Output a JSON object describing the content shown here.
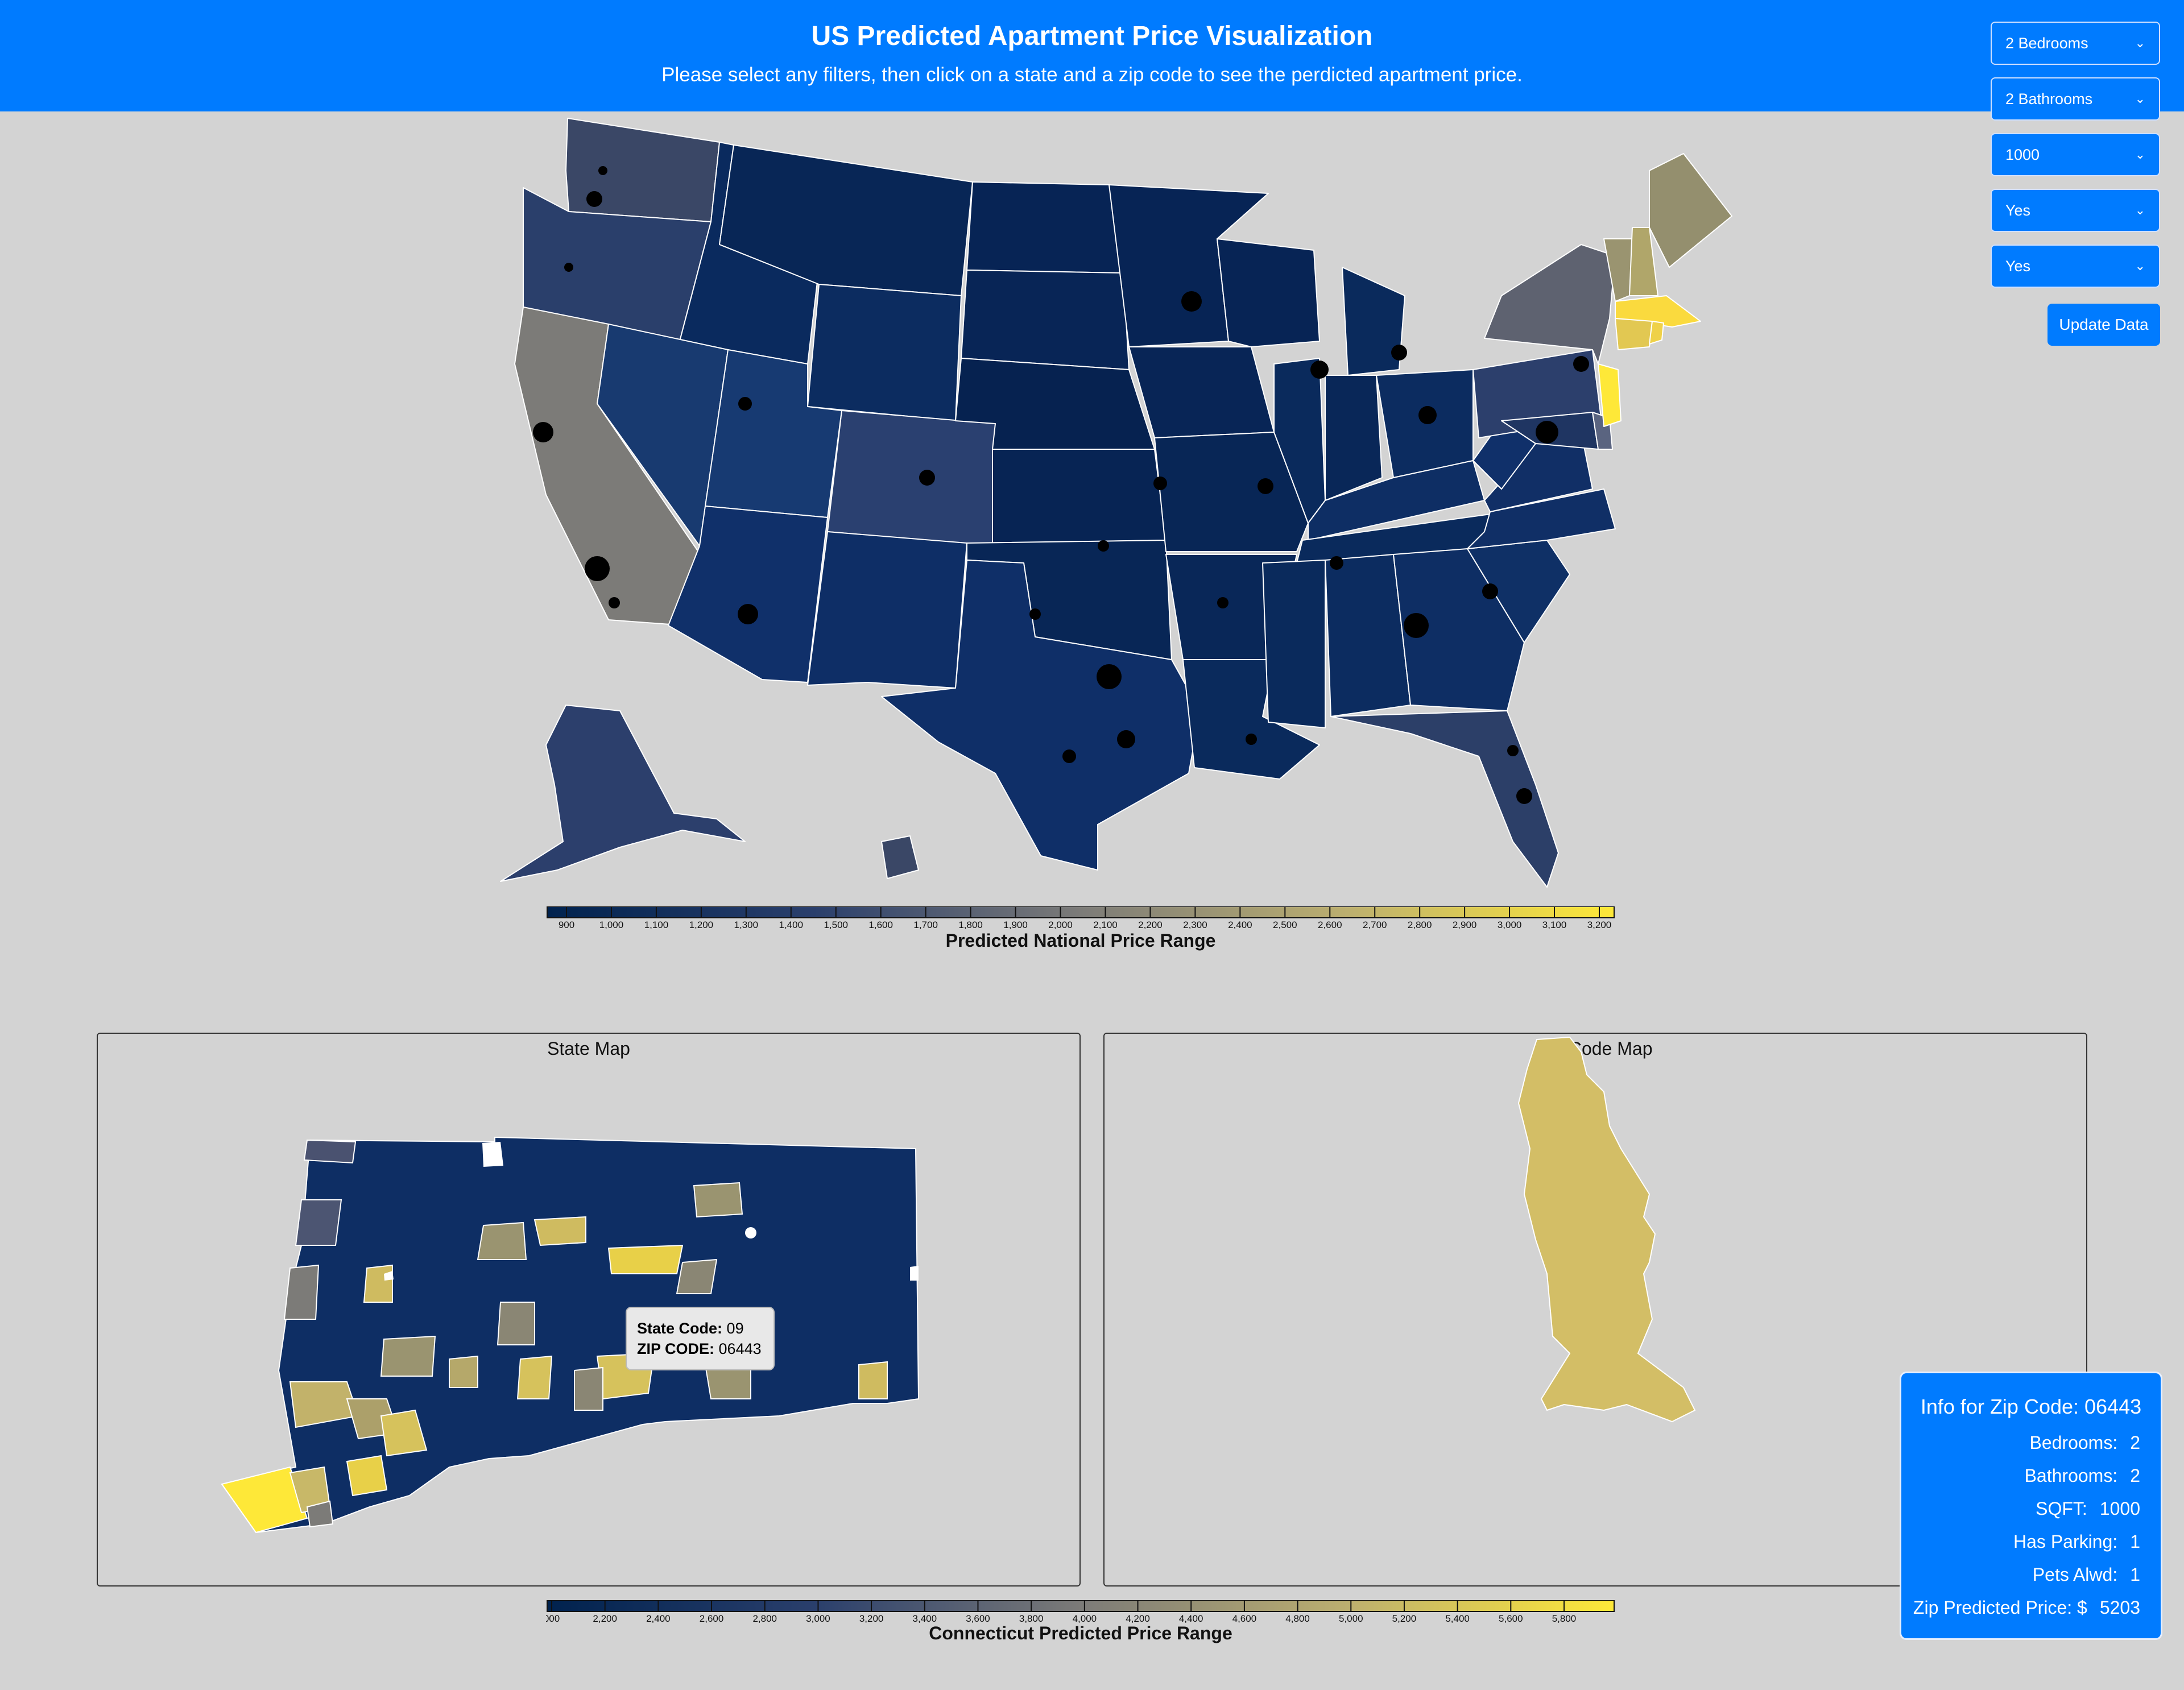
{
  "header": {
    "title": "US Predicted Apartment Price Visualization",
    "subtitle": "Please select any filters, then click on a state and a zip code to see the perdicted apartment price."
  },
  "filters": {
    "bedrooms": "2 Bedrooms",
    "bathrooms": "2 Bathrooms",
    "sqft": "1000",
    "parking": "Yes",
    "pets": "Yes",
    "update_label": "Update Data"
  },
  "national_legend": {
    "title": "Predicted National Price Range",
    "ticks": [
      "900",
      "1,000",
      "1,100",
      "1,200",
      "1,300",
      "1,400",
      "1,500",
      "1,600",
      "1,700",
      "1,800",
      "1,900",
      "2,000",
      "2,100",
      "2,200",
      "2,300",
      "2,400",
      "2,500",
      "2,600",
      "2,700",
      "2,800",
      "2,900",
      "3,000",
      "3,100",
      "3,200"
    ]
  },
  "state_legend": {
    "title": "Connecticut Predicted Price Range",
    "ticks": [
      "000",
      "2,200",
      "2,400",
      "2,600",
      "2,800",
      "3,000",
      "3,200",
      "3,400",
      "3,600",
      "3,800",
      "4,000",
      "4,200",
      "4,400",
      "4,600",
      "4,800",
      "5,000",
      "5,200",
      "5,400",
      "5,600",
      "5,800"
    ]
  },
  "panels": {
    "state_title": "State Map",
    "zip_title": "Zip Code Map"
  },
  "tooltip": {
    "state_label": "State Code:",
    "state_value": "09",
    "zip_label": "ZIP CODE:",
    "zip_value": "06443"
  },
  "info": {
    "title": "Info for Zip Code: 06443",
    "rows": [
      {
        "label": "Bedrooms:",
        "value": "2"
      },
      {
        "label": "Bathrooms:",
        "value": "2"
      },
      {
        "label": "SQFT:",
        "value": "1000"
      },
      {
        "label": "Has Parking:",
        "value": "1"
      },
      {
        "label": "Pets Alwd:",
        "value": "1"
      },
      {
        "label": "Zip Predicted Price: $",
        "value": "5203"
      }
    ]
  },
  "colors": {
    "header": "#007bff",
    "background": "#d3d3d3",
    "scale_low": "#00224e",
    "scale_mid": "#7c7b78",
    "scale_high": "#fee838",
    "zip_fill": "#d3be66"
  }
}
